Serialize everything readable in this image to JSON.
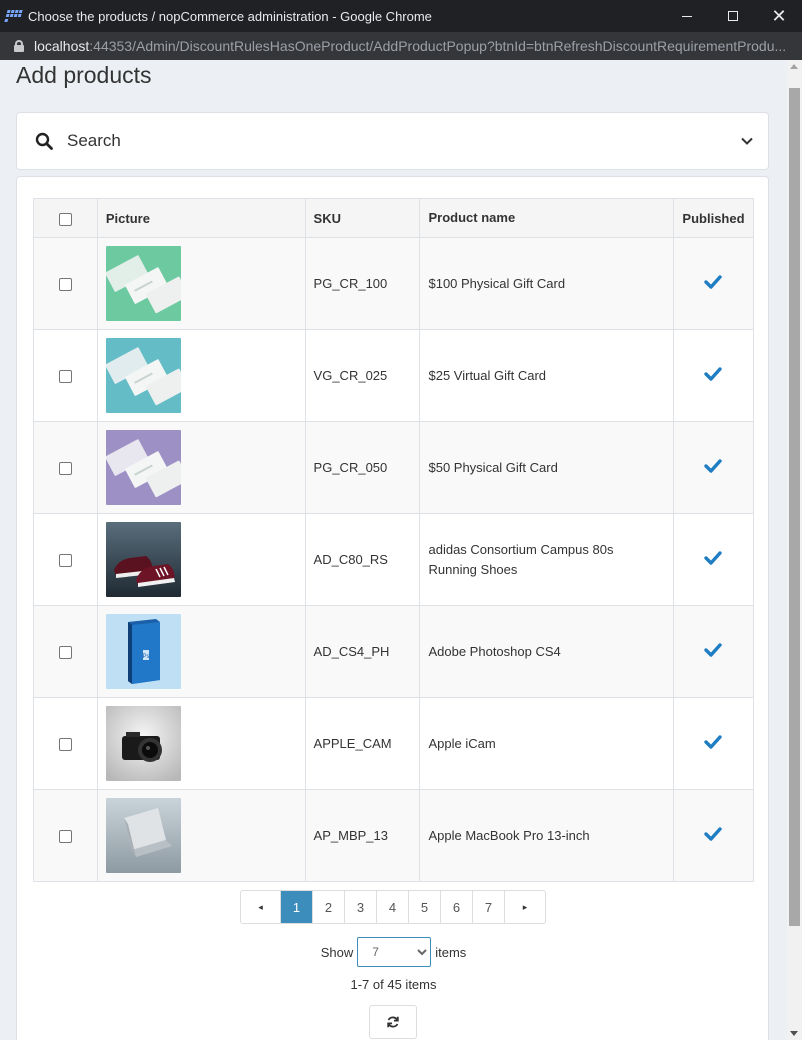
{
  "window": {
    "title": "Choose the products / nopCommerce administration - Google Chrome",
    "url_host": "localhost",
    "url_rest": ":44353/Admin/DiscountRulesHasOneProduct/AddProductPopup?btnId=btnRefreshDiscountRequirementProdu..."
  },
  "page": {
    "title": "Add products",
    "search_label": "Search"
  },
  "grid": {
    "headers": {
      "picture": "Picture",
      "sku": "SKU",
      "name": "Product name",
      "published": "Published"
    },
    "rows": [
      {
        "sku": "PG_CR_100",
        "name": "$100 Physical Gift Card",
        "published": true,
        "image": "gift-card-green"
      },
      {
        "sku": "VG_CR_025",
        "name": "$25 Virtual Gift Card",
        "published": true,
        "image": "gift-card-teal"
      },
      {
        "sku": "PG_CR_050",
        "name": "$50 Physical Gift Card",
        "published": true,
        "image": "gift-card-purple"
      },
      {
        "sku": "AD_C80_RS",
        "name": "adidas Consortium Campus 80s Running Shoes",
        "published": true,
        "image": "shoes"
      },
      {
        "sku": "AD_CS4_PH",
        "name": "Adobe Photoshop CS4",
        "published": true,
        "image": "software-box"
      },
      {
        "sku": "APPLE_CAM",
        "name": "Apple iCam",
        "published": true,
        "image": "camera"
      },
      {
        "sku": "AP_MBP_13",
        "name": "Apple MacBook Pro 13-inch",
        "published": true,
        "image": "laptop"
      }
    ]
  },
  "pager": {
    "pages": [
      "1",
      "2",
      "3",
      "4",
      "5",
      "6",
      "7"
    ],
    "current": "1",
    "prev": "◂",
    "next": "▸"
  },
  "page_size": {
    "show_label": "Show",
    "items_label": "items",
    "selected": "7"
  },
  "info": "1-7 of 45 items",
  "colors": {
    "accent": "#3c8dbc",
    "check": "#1f7dc4"
  }
}
